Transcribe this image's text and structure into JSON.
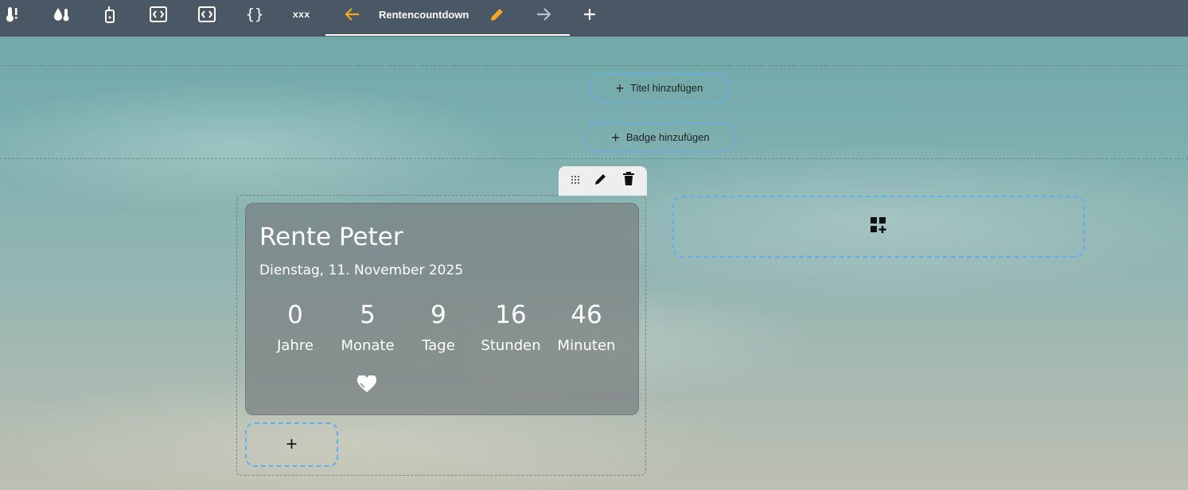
{
  "tabs": {
    "xxx_label": "xxx",
    "current_title": "Rentencountdown"
  },
  "header": {
    "add_title_label": "Titel hinzufügen",
    "add_badge_label": "Badge hinzufügen"
  },
  "card": {
    "name": "Rente Peter",
    "date": "Dienstag, 11. November 2025",
    "counters": [
      {
        "value": "0",
        "label": "Jahre"
      },
      {
        "value": "5",
        "label": "Monate"
      },
      {
        "value": "9",
        "label": "Tage"
      },
      {
        "value": "16",
        "label": "Stunden"
      },
      {
        "value": "46",
        "label": "Minuten"
      }
    ]
  },
  "colors": {
    "topbar": "#4a5866",
    "accent_orange": "#f5a623",
    "dashed_blue": "#62aef0"
  },
  "icons": {
    "tab1": "thermometer-alert-icon",
    "tab2": "water-thermometer-icon",
    "tab3": "remote-icon",
    "tab4": "code-box-icon",
    "tab5": "code-box-icon",
    "tab6": "code-braces-icon",
    "move_left": "arrow-left-icon",
    "edit_view": "pencil-icon",
    "move_right": "arrow-right-icon",
    "add_view": "plus-icon",
    "card_drag": "drag-icon",
    "card_edit": "pencil-icon",
    "card_delete": "trash-icon",
    "card_heart": "heart-icon",
    "add_card": "plus-icon",
    "empty_column": "view-grid-plus-icon"
  }
}
